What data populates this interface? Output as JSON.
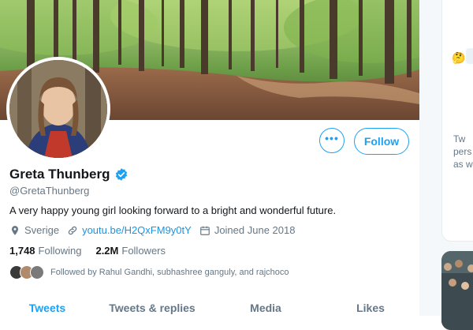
{
  "profile": {
    "name": "Greta Thunberg",
    "handle": "@GretaThunberg",
    "bio": "A very happy young girl looking forward to a bright and wonderful future.",
    "location": "Sverige",
    "website": "youtu.be/H2QxFM9y0tY",
    "joined": "Joined June 2018",
    "following_count": "1,748",
    "following_label": "Following",
    "followers_count": "2.2M",
    "followers_label": "Followers",
    "followed_by": "Followed by Rahul Gandhi, subhashree ganguly, and rajchoco"
  },
  "actions": {
    "more_label": "•••",
    "follow_label": "Follow"
  },
  "tabs": [
    {
      "label": "Tweets",
      "active": true
    },
    {
      "label": "Tweets & replies",
      "active": false
    },
    {
      "label": "Media",
      "active": false
    },
    {
      "label": "Likes",
      "active": false
    }
  ],
  "sidebar_snippet": {
    "line1": "Tw",
    "line2": "pers",
    "line3": "as we"
  },
  "icons": {
    "verified": "verified-badge-icon",
    "location": "location-pin-icon",
    "link": "link-icon",
    "calendar": "calendar-icon",
    "more": "more-icon"
  },
  "colors": {
    "accent": "#1da1f2",
    "link": "#1b95e0",
    "secondary_text": "#657786",
    "primary_text": "#14171a"
  }
}
